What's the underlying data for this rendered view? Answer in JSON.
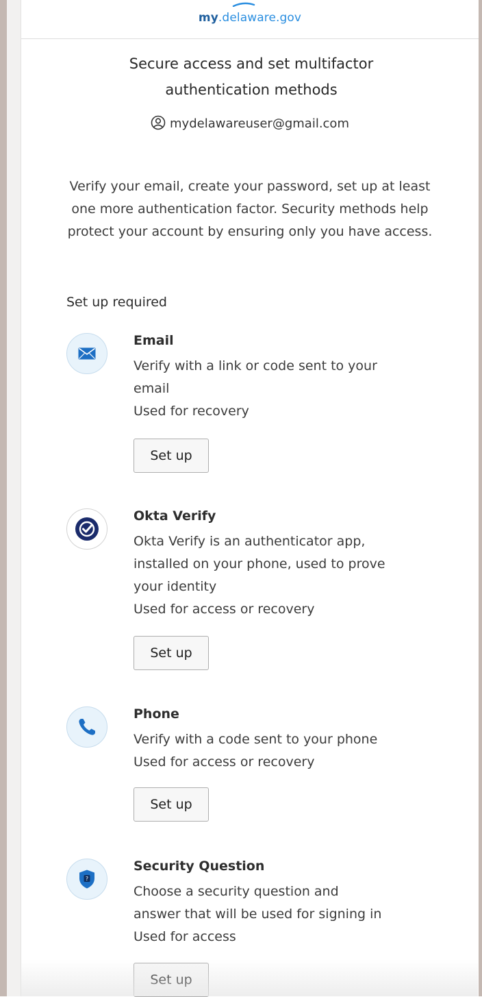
{
  "brand": {
    "prefix": "my",
    "domain": ".delaware.gov"
  },
  "title": "Secure access and set multifactor authentication methods",
  "user": {
    "email": "mydelawareuser@gmail.com",
    "icon": "user-circle-icon"
  },
  "intro": "Verify your email, create your password, set up at least one more authentication factor. Security methods help protect your account by ensuring only you have access.",
  "section_title": "Set up required",
  "factors": [
    {
      "name": "Email",
      "description": [
        "Verify with a link or code sent to your",
        "email",
        "Used for recovery"
      ],
      "button": "Set up",
      "icon": "envelope-icon"
    },
    {
      "name": "Okta Verify",
      "description": [
        "Okta Verify is an authenticator app,",
        "installed on your phone, used to prove",
        "your identity",
        "Used for access or recovery"
      ],
      "button": "Set up",
      "icon": "okta-verify-check-icon"
    },
    {
      "name": "Phone",
      "description": [
        "Verify with a code sent to your phone",
        "Used for access or recovery"
      ],
      "button": "Set up",
      "icon": "phone-icon"
    },
    {
      "name": "Security Question",
      "description": [
        "Choose a security question and",
        "answer that will be used for signing in",
        "Used for access"
      ],
      "button": "Set up",
      "icon": "shield-question-icon"
    }
  ],
  "colors": {
    "brand_dark": "#1f5f9e",
    "brand_light": "#2a8ee0",
    "icon_bg": "#e8f3fb",
    "okta_navy": "#1a2b6b"
  }
}
